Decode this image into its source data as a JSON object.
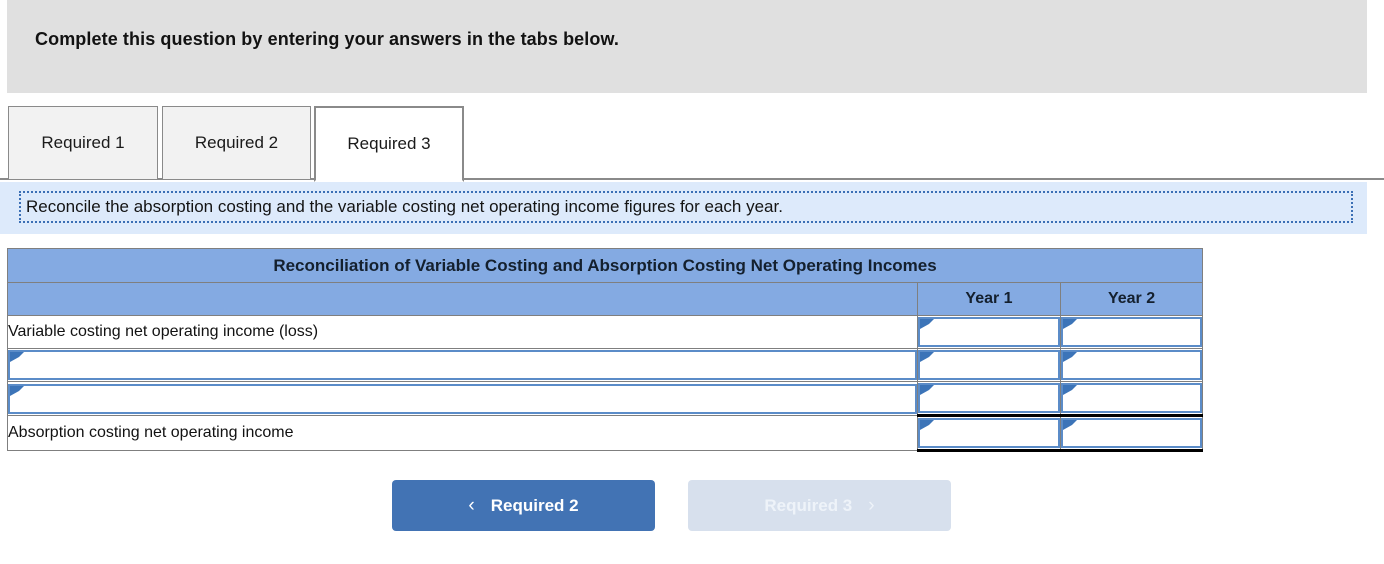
{
  "banner": {
    "text": "Complete this question by entering your answers in the tabs below."
  },
  "tabs": [
    {
      "label": "Required 1",
      "active": false
    },
    {
      "label": "Required 2",
      "active": false
    },
    {
      "label": "Required 3",
      "active": true
    }
  ],
  "instruction": {
    "text": "Reconcile the absorption costing and the variable costing net operating income figures for each year."
  },
  "table": {
    "title": "Reconciliation of Variable Costing and Absorption Costing Net Operating Incomes",
    "blank_header": "",
    "columns": [
      "Year 1",
      "Year 2"
    ],
    "rows": [
      {
        "label": "Variable costing net operating income (loss)",
        "label_editable": false,
        "year1": "",
        "year2": "",
        "total": false
      },
      {
        "label": "",
        "label_editable": true,
        "year1": "",
        "year2": "",
        "total": false
      },
      {
        "label": "",
        "label_editable": true,
        "year1": "",
        "year2": "",
        "total": false
      },
      {
        "label": "Absorption costing net operating income",
        "label_editable": false,
        "year1": "",
        "year2": "",
        "total": true
      }
    ]
  },
  "nav": {
    "prev_label": "Required 2",
    "prev_chevron": "‹",
    "next_label": "Required 3",
    "next_chevron": "›"
  },
  "colors": {
    "banner_bg": "#e0e0e0",
    "table_header_blue": "#84aae2",
    "instruction_bg": "#ddeafb",
    "instruction_border": "#3b6fb5",
    "button_active": "#4273b4",
    "button_disabled": "#d7e0ed",
    "input_border": "#5b8cc8",
    "marker": "#3c74b8"
  }
}
